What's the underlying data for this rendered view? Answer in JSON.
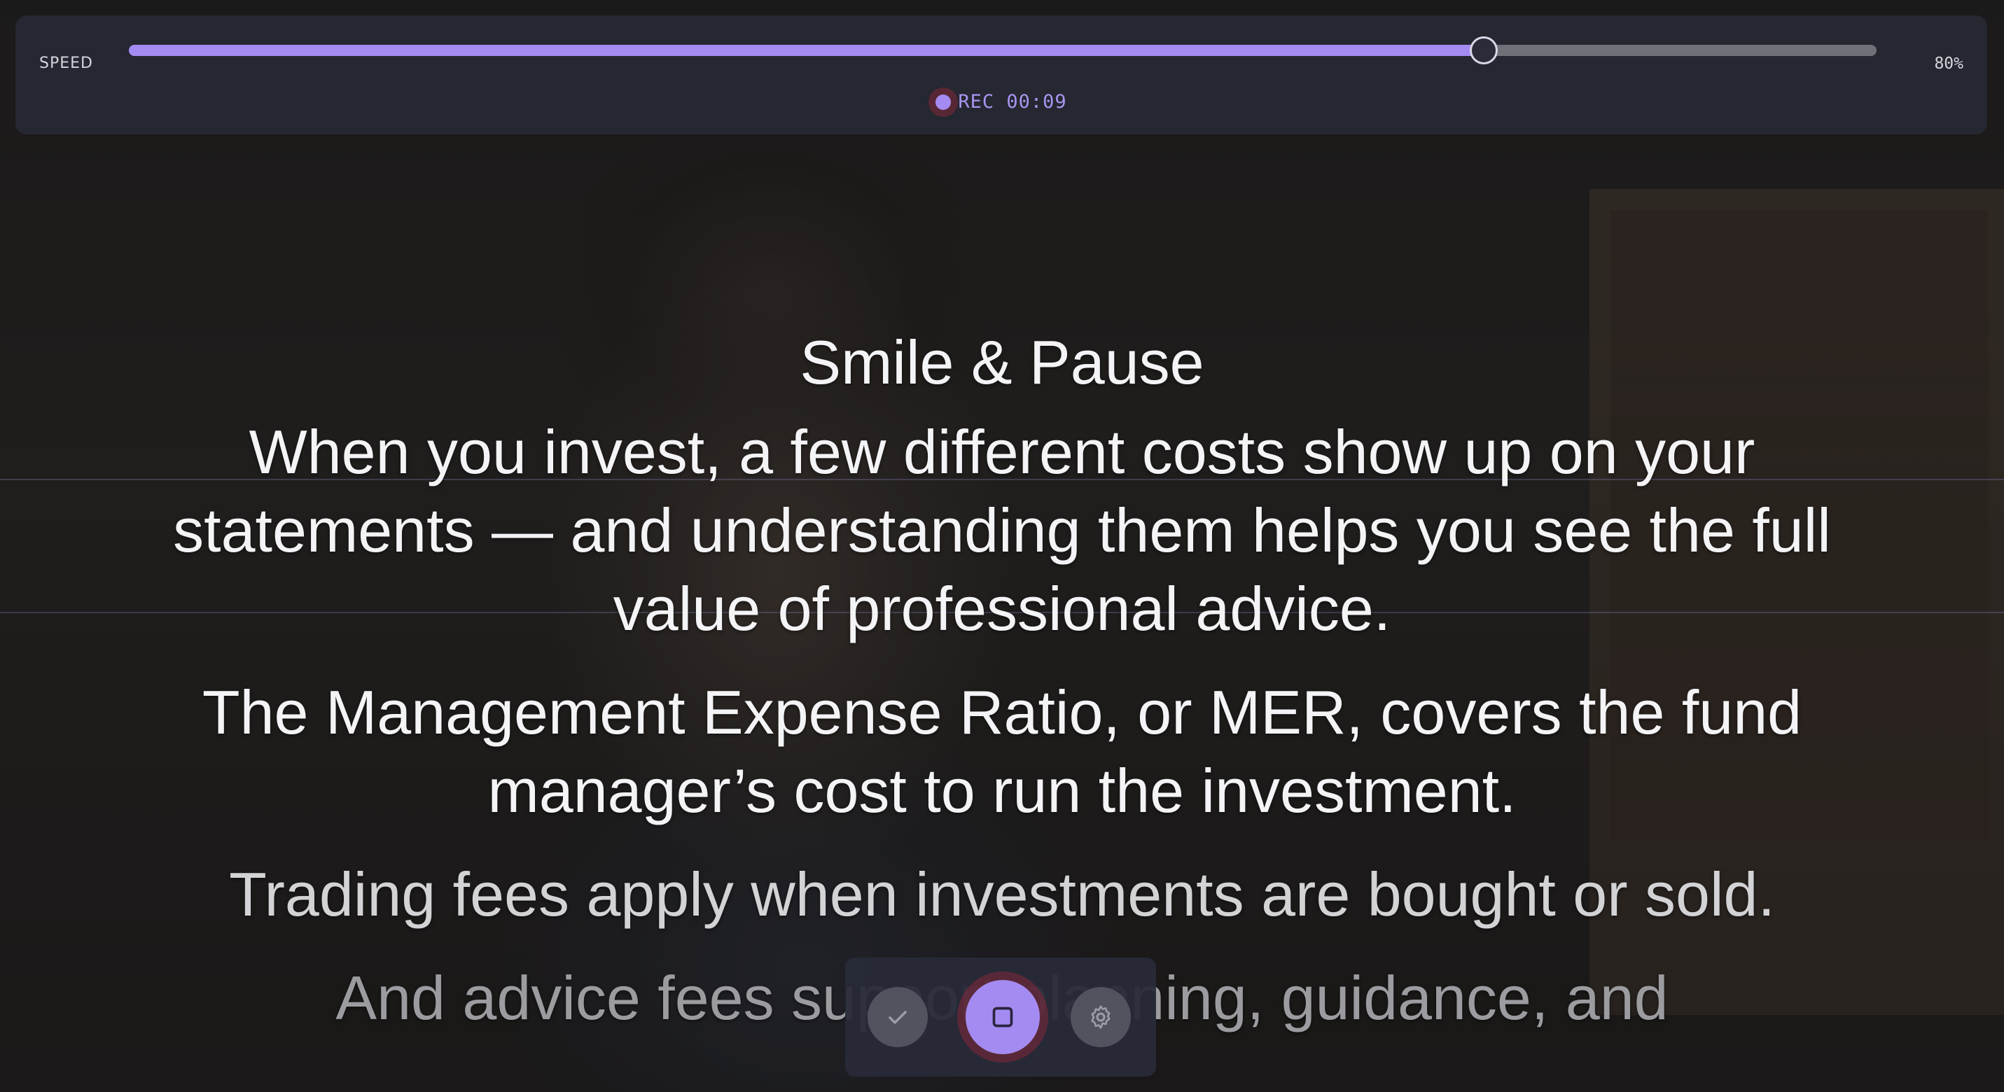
{
  "speed": {
    "label": "SPEED",
    "value_text": "80%",
    "fraction": 0.775
  },
  "recording": {
    "label": "REC 00:09",
    "indicator_color": "#a48bf1"
  },
  "script": {
    "title": "Smile & Pause",
    "paragraphs": [
      "When you invest, a few different costs show up on your statements — and understanding them helps you see the full value of professional advice.",
      "The Management Expense Ratio, or MER, covers the fund manager’s cost to run the investment.",
      "Trading fees apply when investments are bought or sold.",
      "And advice fees support planning, guidance, and"
    ]
  },
  "controls": {
    "confirm_icon": "check-icon",
    "stop_icon": "stop-icon",
    "settings_icon": "gear-icon"
  },
  "colors": {
    "accent": "#a48bf1",
    "panel": "#262934",
    "track": "#6f7078"
  }
}
